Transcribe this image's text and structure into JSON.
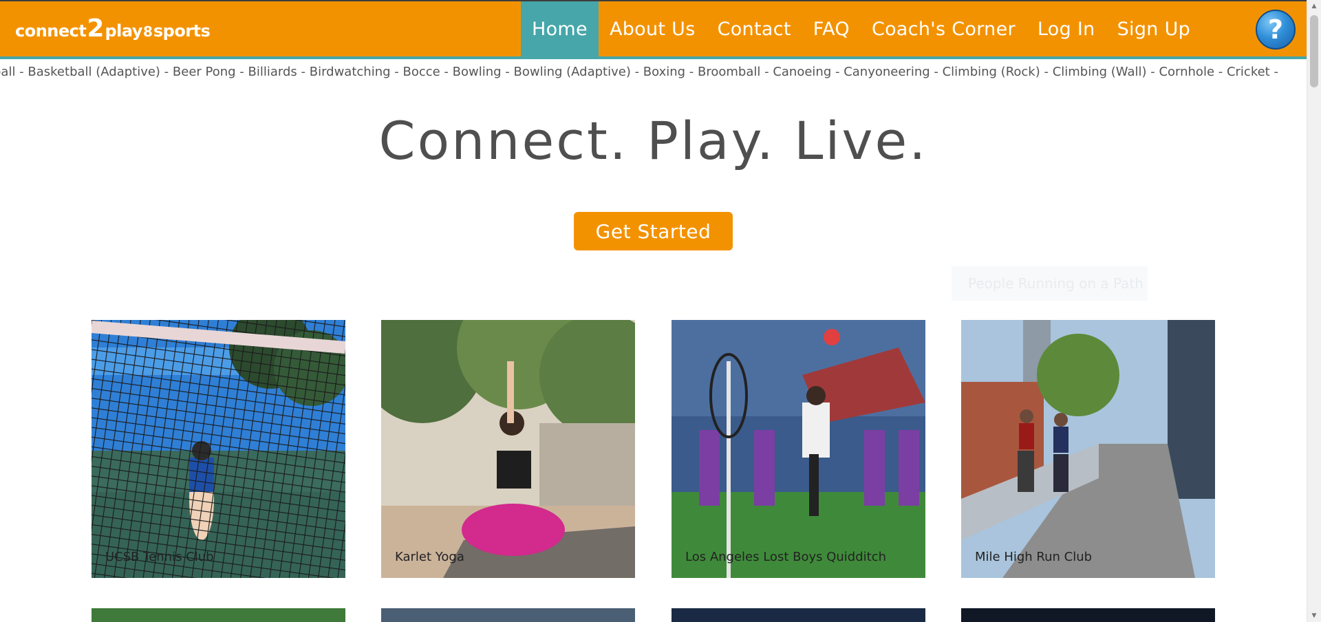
{
  "brand": {
    "p1": "connect",
    "p2": "2",
    "p3": "play",
    "p4": "8",
    "p5": "sports"
  },
  "nav": {
    "items": [
      "Home",
      "About Us",
      "Contact",
      "FAQ",
      "Coach's Corner",
      "Log In",
      "Sign Up"
    ],
    "active": "Home",
    "help_symbol": "?"
  },
  "ticker": "ball - Basketball (Adaptive) - Beer Pong - Billiards - Birdwatching - Bocce - Bowling - Bowling (Adaptive) - Boxing - Broomball - Canoeing - Canyoneering - Climbing (Rock) - Climbing (Wall) - Cornhole - Cricket -",
  "hero": {
    "title": "Connect. Play. Live.",
    "cta": "Get Started"
  },
  "ghost_label": "People Running on a Path",
  "cards": [
    {
      "label": "UCSB Tennis Club",
      "icon": "tennis-photo"
    },
    {
      "label": "Karlet Yoga",
      "icon": "yoga-photo"
    },
    {
      "label": "Los Angeles Lost Boys Quidditch",
      "icon": "quidditch-photo"
    },
    {
      "label": "Mile High Run Club",
      "icon": "running-photo"
    }
  ],
  "colors": {
    "orange": "#f39200",
    "teal": "#46a6a9",
    "text": "#555555"
  }
}
